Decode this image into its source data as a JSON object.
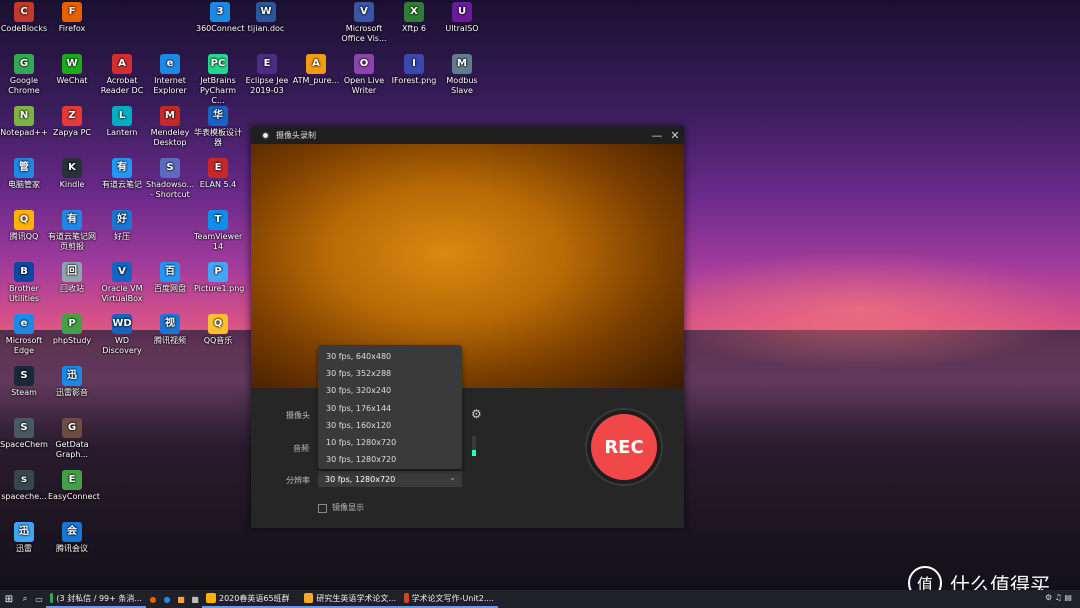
{
  "desktop": {
    "icons": [
      {
        "label": "CodeBlocks",
        "color": "#c0392b",
        "glyph": "C"
      },
      {
        "label": "Firefox",
        "color": "#e66000",
        "glyph": "F"
      },
      {
        "label": "360Connect",
        "color": "#1e88e5",
        "glyph": "3"
      },
      {
        "label": "tijian.doc",
        "color": "#2b579a",
        "glyph": "W"
      },
      {
        "label": "Microsoft Office Vis...",
        "color": "#3955a3",
        "glyph": "V"
      },
      {
        "label": "Xftp 6",
        "color": "#2e7d32",
        "glyph": "X"
      },
      {
        "label": "UltraISO",
        "color": "#6a1b9a",
        "glyph": "U"
      },
      {
        "label": "Google Chrome",
        "color": "#34a853",
        "glyph": "G"
      },
      {
        "label": "WeChat",
        "color": "#1aad19",
        "glyph": "W"
      },
      {
        "label": "Acrobat Reader DC",
        "color": "#d32f2f",
        "glyph": "A"
      },
      {
        "label": "Internet Explorer",
        "color": "#1e88e5",
        "glyph": "e"
      },
      {
        "label": "JetBrains PyCharm C...",
        "color": "#21d789",
        "glyph": "PC"
      },
      {
        "label": "Eclipse Jee 2019-03",
        "color": "#4b2e83",
        "glyph": "E"
      },
      {
        "label": "ATM_pure...",
        "color": "#f39c12",
        "glyph": "A"
      },
      {
        "label": "Open Live Writer",
        "color": "#8e44ad",
        "glyph": "O"
      },
      {
        "label": "IForest.png",
        "color": "#3949ab",
        "glyph": "I"
      },
      {
        "label": "Modbus Slave",
        "color": "#607d8b",
        "glyph": "M"
      },
      {
        "label": "Notepad++",
        "color": "#7cb342",
        "glyph": "N"
      },
      {
        "label": "Zapya PC",
        "color": "#e53935",
        "glyph": "Z"
      },
      {
        "label": "Lantern",
        "color": "#00acc1",
        "glyph": "L"
      },
      {
        "label": "Mendeley Desktop",
        "color": "#c62828",
        "glyph": "M"
      },
      {
        "label": "华表模板设计器",
        "color": "#1565c0",
        "glyph": "华"
      },
      {
        "label": "电脑管家",
        "color": "#1e88e5",
        "glyph": "管"
      },
      {
        "label": "Kindle",
        "color": "#263238",
        "glyph": "K"
      },
      {
        "label": "有道云笔记",
        "color": "#2196f3",
        "glyph": "有"
      },
      {
        "label": "Shadowso... - Shortcut",
        "color": "#5c6bc0",
        "glyph": "S"
      },
      {
        "label": "ELAN 5.4",
        "color": "#c62828",
        "glyph": "E"
      },
      {
        "label": "腾讯QQ",
        "color": "#ffb300",
        "glyph": "Q"
      },
      {
        "label": "有道云笔记网页剪报",
        "color": "#1e88e5",
        "glyph": "有"
      },
      {
        "label": "好压",
        "color": "#1976d2",
        "glyph": "好"
      },
      {
        "label": "TeamViewer 14",
        "color": "#0e8ee9",
        "glyph": "T"
      },
      {
        "label": "Brother Utilities",
        "color": "#0d47a1",
        "glyph": "B"
      },
      {
        "label": "回收站",
        "color": "#90a4ae",
        "glyph": "回"
      },
      {
        "label": "Oracle VM VirtualBox",
        "color": "#1565c0",
        "glyph": "V"
      },
      {
        "label": "百度网盘",
        "color": "#2196f3",
        "glyph": "百"
      },
      {
        "label": "Picture1.png",
        "color": "#42a5f5",
        "glyph": "P"
      },
      {
        "label": "Microsoft Edge",
        "color": "#1e88e5",
        "glyph": "e"
      },
      {
        "label": "phpStudy",
        "color": "#43a047",
        "glyph": "P"
      },
      {
        "label": "WD Discovery",
        "color": "#1565c0",
        "glyph": "WD"
      },
      {
        "label": "腾讯视频",
        "color": "#1976d2",
        "glyph": "视"
      },
      {
        "label": "QQ音乐",
        "color": "#fbc02d",
        "glyph": "Q"
      },
      {
        "label": "Steam",
        "color": "#1b2838",
        "glyph": "S"
      },
      {
        "label": "迅雷影音",
        "color": "#1e88e5",
        "glyph": "迅"
      },
      {
        "label": "SpaceChem",
        "color": "#455a64",
        "glyph": "S"
      },
      {
        "label": "GetData Graph...",
        "color": "#6d4c41",
        "glyph": "G"
      },
      {
        "label": "spaceche...",
        "color": "#37474f",
        "glyph": "s"
      },
      {
        "label": "EasyConnect",
        "color": "#43a047",
        "glyph": "E"
      },
      {
        "label": "迅雷",
        "color": "#42a5f5",
        "glyph": "迅"
      },
      {
        "label": "腾讯会议",
        "color": "#1976d2",
        "glyph": "会"
      }
    ]
  },
  "window": {
    "title": "摄像头录制",
    "minimize": "—",
    "close": "✕",
    "camera_label": "摄像头",
    "audio_label": "音频",
    "resolution_label": "分辨率",
    "resolution_value": "30 fps, 1280x720",
    "resolution_options": [
      "30 fps, 640x480",
      "30 fps, 352x288",
      "30 fps, 320x240",
      "30 fps, 176x144",
      "30 fps, 160x120",
      "10 fps, 1280x720",
      "30 fps, 1280x720"
    ],
    "mirror_label": "镜像显示",
    "rec_label": "REC",
    "colors": {
      "rec": "#f04848",
      "background": "#262626"
    }
  },
  "taskbar": {
    "items": [
      {
        "label": "(3 封私信 / 99+ 条消..."
      },
      {
        "label": "2020春英语65班群"
      },
      {
        "label": "研究生英语学术论文..."
      },
      {
        "label": "学术论文写作-Unit2...."
      }
    ]
  },
  "watermark": {
    "glyph": "值",
    "text": "什么值得买"
  }
}
